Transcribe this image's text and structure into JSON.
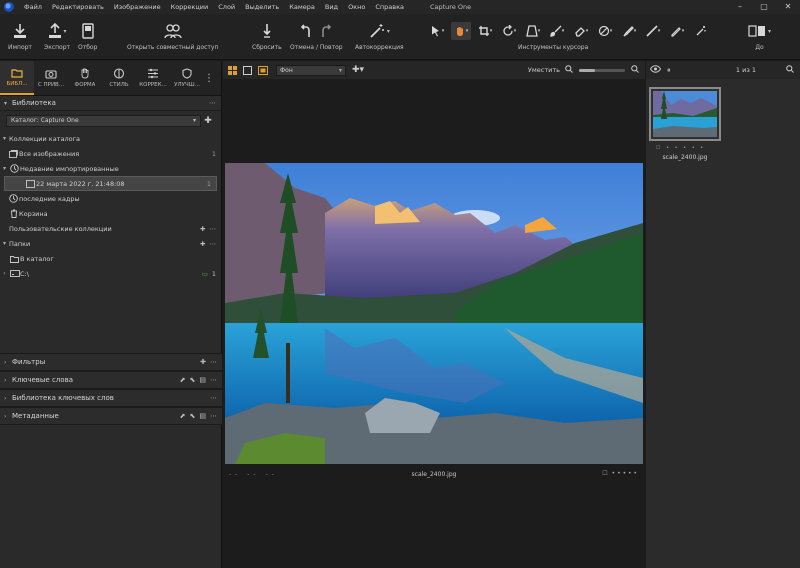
{
  "menu": {
    "items": [
      "Файл",
      "Редактировать",
      "Изображение",
      "Коррекции",
      "Слой",
      "Выделить",
      "Камера",
      "Вид",
      "Окно",
      "Справка"
    ],
    "title": "Capture One"
  },
  "toolbar": {
    "import": "Импорт",
    "export": "Экспорт",
    "select": "Отбор",
    "share": "Открыть совместный доступ",
    "reset": "Сбросить",
    "undo_redo": "Отмена / Повтор",
    "autocorrect": "Автокоррекция",
    "cursor_tools": "Инструменты курсора",
    "more": "До"
  },
  "tool_tabs": [
    {
      "label": "БИБЛ...",
      "icon": "folder-icon"
    },
    {
      "label": "С ПРИВ...",
      "icon": "camera-icon"
    },
    {
      "label": "ФОРМА",
      "icon": "hand-icon"
    },
    {
      "label": "СТИЛЬ",
      "icon": "style-icon"
    },
    {
      "label": "КОРРЕК...",
      "icon": "sliders-icon"
    },
    {
      "label": "УЛУЧШ...",
      "icon": "shield-icon"
    }
  ],
  "library": {
    "title": "Библиотека",
    "catalog": "Каталог: Capture One",
    "collections_header": "Коллекции каталога",
    "all_images": "Все изображения",
    "all_images_count": "1",
    "recent_imports": "Недавние импортированные",
    "import_date": "22 марта 2022 г. 21:48:08",
    "import_count": "1",
    "recent_captures": "последние кадры",
    "trash": "Корзина",
    "user_collections": "Пользовательские коллекции",
    "folders": "Папки",
    "in_catalog": "В каталог",
    "drive": "C:\\",
    "drive_count": "1"
  },
  "lower_sections": {
    "filters": "Фильтры",
    "keywords": "Ключевые слова",
    "keyword_library": "Библиотека ключевых слов",
    "metadata": "Метаданные"
  },
  "viewer": {
    "background_select": "Фон",
    "fit": "Уместить",
    "zoom_fraction": 0.35,
    "filename": "scale_2400.jpg"
  },
  "browser": {
    "counter": "1 из 1",
    "thumb_name": "scale_2400.jpg"
  },
  "colors": {
    "accent": "#e0a030",
    "panel": "#2a2a2a"
  }
}
